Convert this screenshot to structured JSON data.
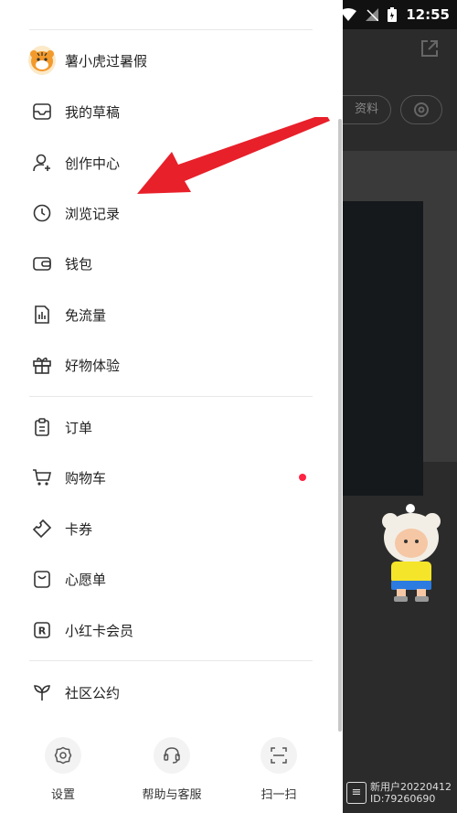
{
  "status_bar": {
    "time": "12:55"
  },
  "background": {
    "profile_pill": "资料",
    "user_name": "新用户20220412",
    "user_id": "ID:79260690"
  },
  "profile": {
    "name": "薯小虎过暑假"
  },
  "menu_groups": [
    [
      {
        "label": "我的草稿",
        "icon": "inbox-icon"
      },
      {
        "label": "创作中心",
        "icon": "user-plus-icon"
      },
      {
        "label": "浏览记录",
        "icon": "clock-icon"
      },
      {
        "label": "钱包",
        "icon": "wallet-icon"
      },
      {
        "label": "免流量",
        "icon": "data-chart-icon"
      },
      {
        "label": "好物体验",
        "icon": "gift-icon"
      }
    ],
    [
      {
        "label": "订单",
        "icon": "clipboard-icon"
      },
      {
        "label": "购物车",
        "icon": "cart-icon",
        "badge": true
      },
      {
        "label": "卡券",
        "icon": "coupon-icon"
      },
      {
        "label": "心愿单",
        "icon": "wish-bag-icon"
      },
      {
        "label": "小红卡会员",
        "icon": "r-card-icon"
      }
    ],
    [
      {
        "label": "社区公约",
        "icon": "sprout-icon"
      }
    ]
  ],
  "bottom_bar": [
    {
      "label": "设置",
      "icon": "gear-icon"
    },
    {
      "label": "帮助与客服",
      "icon": "headset-icon"
    },
    {
      "label": "扫一扫",
      "icon": "scan-icon"
    }
  ],
  "colors": {
    "accent": "#ff2442",
    "arrow": "#e8202a"
  }
}
